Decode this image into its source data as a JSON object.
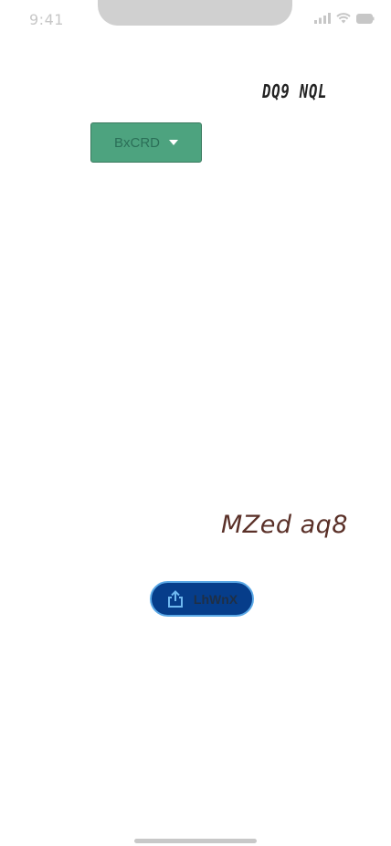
{
  "status_bar": {
    "time": "9:41",
    "icons": [
      "signal-icon",
      "wifi-icon",
      "battery-icon"
    ]
  },
  "header": {
    "label": "DQ9 NQL"
  },
  "dropdown": {
    "selected": "BxCRD",
    "color": "#4da37f"
  },
  "main": {
    "heading": "MZed aq8"
  },
  "share_button": {
    "label": "LhWnX",
    "icon": "share-icon",
    "color": "#063d8a"
  }
}
